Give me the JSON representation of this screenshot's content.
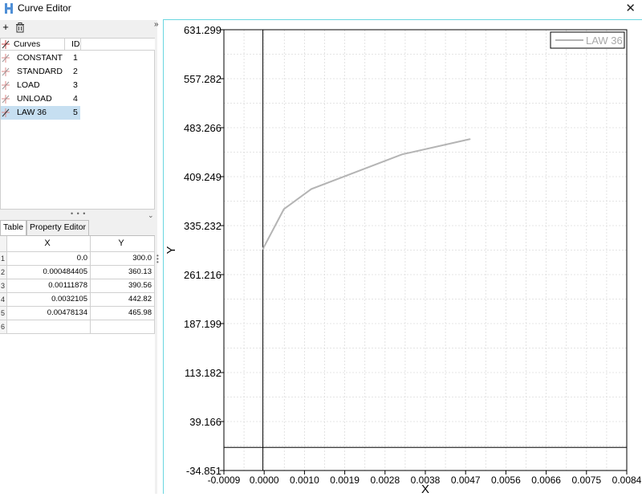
{
  "window": {
    "title": "Curve Editor",
    "close_glyph": "✕",
    "collapse_glyph": "»"
  },
  "toolbar": {
    "add_glyph": "+",
    "delete_icon": "trash-icon"
  },
  "curves_list": {
    "columns": [
      "Curves",
      "ID"
    ],
    "items": [
      {
        "name": "CONSTANT",
        "id": "1",
        "selected": false
      },
      {
        "name": "STANDARD",
        "id": "2",
        "selected": false
      },
      {
        "name": "LOAD",
        "id": "3",
        "selected": false
      },
      {
        "name": "UNLOAD",
        "id": "4",
        "selected": false
      },
      {
        "name": "LAW 36",
        "id": "5",
        "selected": true
      }
    ],
    "selection_color": "#c6dff1"
  },
  "tabs": [
    {
      "label": "Table",
      "active": true
    },
    {
      "label": "Property Editor",
      "active": false
    }
  ],
  "table": {
    "columns": [
      "X",
      "Y"
    ],
    "rows": [
      {
        "n": "1",
        "x": "0.0",
        "y": "300.0"
      },
      {
        "n": "2",
        "x": "0.000484405",
        "y": "360.13"
      },
      {
        "n": "3",
        "x": "0.00111878",
        "y": "390.56"
      },
      {
        "n": "4",
        "x": "0.0032105",
        "y": "442.82"
      },
      {
        "n": "5",
        "x": "0.00478134",
        "y": "465.98"
      },
      {
        "n": "6",
        "x": "",
        "y": ""
      }
    ]
  },
  "chart_data": {
    "type": "line",
    "xlabel": "X",
    "ylabel": "Y",
    "xlim": [
      -0.0009,
      0.0084
    ],
    "ylim": [
      -34.851,
      631.299
    ],
    "x_ticks": [
      "-0.0009",
      "0.0000",
      "0.0010",
      "0.0019",
      "0.0028",
      "0.0038",
      "0.0047",
      "0.0056",
      "0.0066",
      "0.0075",
      "0.0084"
    ],
    "y_ticks": [
      "631.299",
      "557.282",
      "483.266",
      "409.249",
      "335.232",
      "261.216",
      "187.199",
      "113.182",
      "39.166",
      "-34.851"
    ],
    "grid": true,
    "legend_position": "top-right",
    "series": [
      {
        "name": "LAW 36",
        "color": "#b4b4b4",
        "x": [
          0.0,
          0.000484405,
          0.00111878,
          0.0032105,
          0.00478134
        ],
        "y": [
          300.0,
          360.13,
          390.56,
          442.82,
          465.98
        ]
      }
    ]
  }
}
